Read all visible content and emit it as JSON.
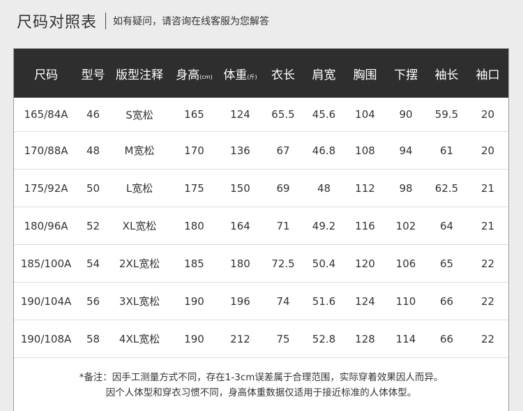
{
  "header": {
    "title": "尺码对照表",
    "subtitle": "如有疑问，请咨询在线客服为您解答"
  },
  "table": {
    "columns": [
      {
        "label": "尺码",
        "unit": ""
      },
      {
        "label": "型号",
        "unit": ""
      },
      {
        "label": "版型注释",
        "unit": ""
      },
      {
        "label": "身高",
        "unit": "(cm)"
      },
      {
        "label": "体重",
        "unit": "(斤)"
      },
      {
        "label": "衣长",
        "unit": ""
      },
      {
        "label": "肩宽",
        "unit": ""
      },
      {
        "label": "胸围",
        "unit": ""
      },
      {
        "label": "下摆",
        "unit": ""
      },
      {
        "label": "袖长",
        "unit": ""
      },
      {
        "label": "袖口",
        "unit": ""
      }
    ],
    "rows": [
      [
        "165/84A",
        "46",
        "S宽松",
        "165",
        "124",
        "65.5",
        "45.6",
        "104",
        "90",
        "59.5",
        "20"
      ],
      [
        "170/88A",
        "48",
        "M宽松",
        "170",
        "136",
        "67",
        "46.8",
        "108",
        "94",
        "61",
        "20"
      ],
      [
        "175/92A",
        "50",
        "L宽松",
        "175",
        "150",
        "69",
        "48",
        "112",
        "98",
        "62.5",
        "21"
      ],
      [
        "180/96A",
        "52",
        "XL宽松",
        "180",
        "164",
        "71",
        "49.2",
        "116",
        "102",
        "64",
        "21"
      ],
      [
        "185/100A",
        "54",
        "2XL宽松",
        "185",
        "180",
        "72.5",
        "50.4",
        "120",
        "106",
        "65",
        "22"
      ],
      [
        "190/104A",
        "56",
        "3XL宽松",
        "190",
        "196",
        "74",
        "51.6",
        "124",
        "110",
        "66",
        "22"
      ],
      [
        "190/108A",
        "58",
        "4XL宽松",
        "190",
        "212",
        "75",
        "52.8",
        "128",
        "114",
        "66",
        "22"
      ]
    ]
  },
  "note": {
    "line1": "*备注：因手工测量方式不同，存在1-3cm误差属于合理范围，实际穿着效果因人而异。",
    "line2": "因个人体型和穿衣习惯不同，身高体重数据仅适用于接近标准的人体体型。"
  },
  "colors": {
    "header_bg": "#2e2e2e",
    "page_bg": "#ececec",
    "divider": "#dedede"
  }
}
